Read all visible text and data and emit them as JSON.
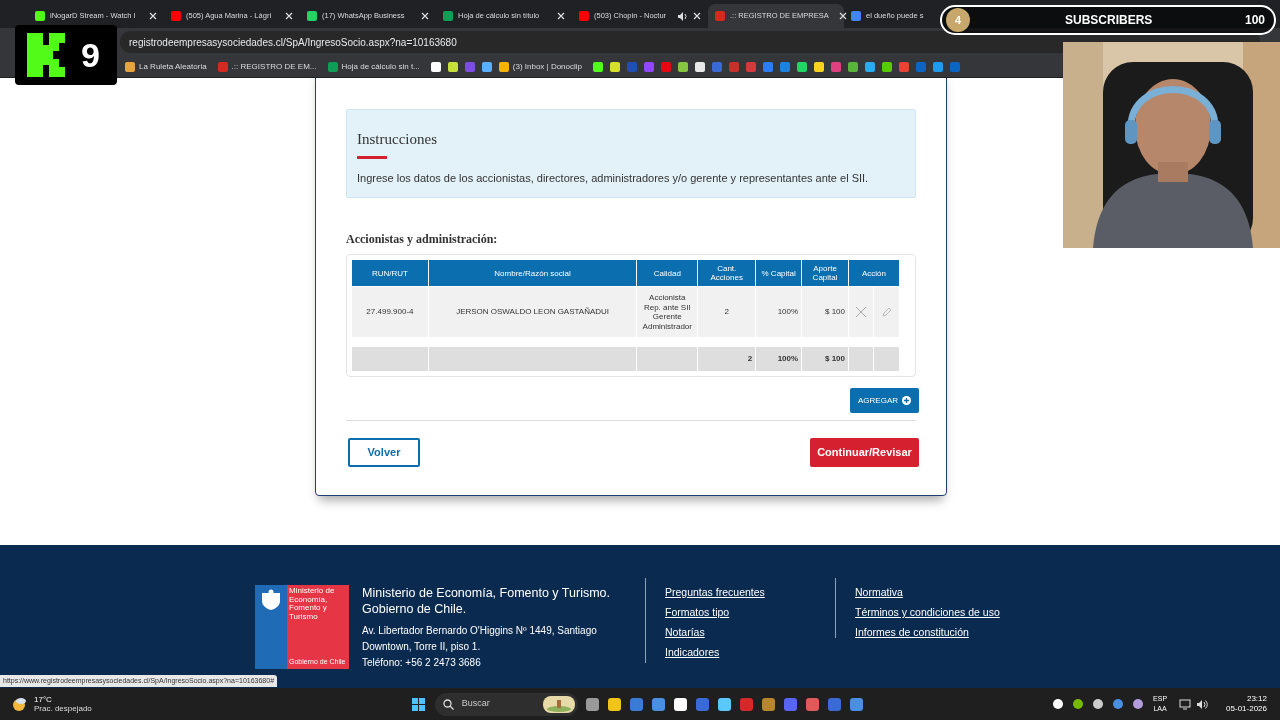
{
  "browser": {
    "tabs": [
      {
        "title": "iNogarD Stream - Watch l",
        "selected": false,
        "audio": false
      },
      {
        "title": "(505) Agua Marina - Lágri",
        "selected": false,
        "audio": false
      },
      {
        "title": "(17) WhatsApp Business",
        "selected": false,
        "audio": false
      },
      {
        "title": "Hoja de cálculo sin título",
        "selected": false,
        "audio": false
      },
      {
        "title": "(503) Chopin - Noctur",
        "selected": false,
        "audio": true
      },
      {
        "title": ".:: REGISTRO DE EMPRESA",
        "selected": true,
        "audio": false
      },
      {
        "title": "el dueño puede s",
        "selected": false,
        "audio": false
      }
    ],
    "address": "registrodeempresasysociedades.cl/SpA/IngresoSocio.aspx?na=10163680",
    "bookmarks": [
      {
        "label": "La Ruleta Aleatoria"
      },
      {
        "label": ".:: REGISTRO DE EM..."
      },
      {
        "label": "Hoja de cálculo sin t..."
      },
      {
        "label": "(3) Inbox | Donoclip"
      }
    ]
  },
  "overlay": {
    "logo_number": "9",
    "subscribers": {
      "count": "4",
      "label": "SUBSCRIBERS",
      "goal": "100"
    }
  },
  "instructions": {
    "title": "Instrucciones",
    "text": "Ingrese los datos de los accionistas, directores, administradores y/o gerente y representantes ante el SII."
  },
  "section_title": "Accionistas y administración:",
  "table": {
    "columns": [
      "RUN/RUT",
      "Nombre/Razón social",
      "Calidad",
      "Cant. Acciones",
      "% Capital",
      "Aporte Capital",
      "Acción"
    ],
    "rows": [
      {
        "cells": [
          "27.499.900-4",
          "JERSON OSWALDO LEON GASTAÑADUI",
          "Accionista Rep. ante SII Gerente Administrador",
          "2",
          "100%",
          "$ 100"
        ]
      }
    ],
    "totals": [
      "2",
      "100%",
      "$ 100"
    ]
  },
  "buttons": {
    "add": "AGREGAR",
    "back": "Volver",
    "next": "Continuar/Revisar"
  },
  "footer": {
    "logo_text": "Ministerio de Economía, Fomento y Turismo",
    "logo_caption": "Gobierno de Chile",
    "title": "Ministerio de Economía, Fomento y Turismo. Gobierno de Chile.",
    "address": [
      "Av. Libertador Bernardo O'Higgins Nº 1449, Santiago",
      "Downtown, Torre II, piso 1.",
      "Teléfono: +56 2 2473 3686"
    ],
    "links_1": [
      "Preguntas frecuentes",
      "Formatos tipo",
      "Notarías",
      "Indicadores"
    ],
    "links_2": [
      "Normativa",
      "Términos y condiciones de uso",
      "Informes de constitución"
    ]
  },
  "status_url": "https://www.registrodeempresasysociedades.cl/SpA/IngresoSocio.aspx?na=10163680#",
  "taskbar": {
    "temperature": "17°C",
    "weather": "Prac. despejado",
    "search_placeholder": "Buscar",
    "language": "ESP",
    "layout": "LAA",
    "time": "23:12",
    "date": "05-01-2026"
  }
}
